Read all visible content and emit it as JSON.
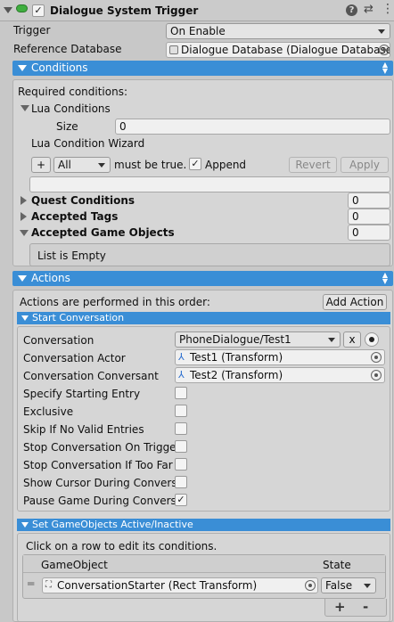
{
  "header": {
    "title": "Dialogue System Trigger",
    "enabled_checked": "✓",
    "trigger_label": "Trigger",
    "trigger_value": "On Enable",
    "refdb_label": "Reference Database",
    "refdb_value": "Dialogue Database (Dialogue Database"
  },
  "conditions": {
    "header": "Conditions",
    "required": "Required conditions:",
    "lua_conditions": "Lua Conditions",
    "size_label": "Size",
    "size_value": "0",
    "wizard_label": "Lua Condition Wizard",
    "plus": "+",
    "all_value": "All",
    "must_be_true": "must be true.",
    "append_check": "✓",
    "append_label": "Append",
    "revert": "Revert",
    "apply": "Apply",
    "quest_conditions": "Quest Conditions",
    "quest_value": "0",
    "accepted_tags": "Accepted Tags",
    "tags_value": "0",
    "accepted_gameobjects": "Accepted Game Objects",
    "gameobjects_value": "0",
    "list_empty": "List is Empty"
  },
  "actions": {
    "header": "Actions",
    "order_text": "Actions are performed in this order:",
    "add_action": "Add Action",
    "start_conversation": {
      "header": "Start Conversation",
      "conversation_label": "Conversation",
      "conversation_value": "PhoneDialogue/Test1",
      "x_button": "x",
      "actor_label": "Conversation Actor",
      "actor_value": "Test1 (Transform)",
      "conversant_label": "Conversation Conversant",
      "conversant_value": "Test2 (Transform)",
      "rows": [
        {
          "label": "Specify Starting Entry",
          "check": ""
        },
        {
          "label": "Exclusive",
          "check": ""
        },
        {
          "label": "Skip If No Valid Entries",
          "check": ""
        },
        {
          "label": "Stop Conversation On Trigger",
          "check": ""
        },
        {
          "label": "Stop Conversation If Too Far",
          "check": ""
        },
        {
          "label": "Show Cursor During Conversa",
          "check": ""
        },
        {
          "label": "Pause Game During Conversa",
          "check": "✓"
        }
      ]
    },
    "set_active": {
      "header": "Set GameObjects Active/Inactive",
      "hint": "Click on a row to edit its conditions.",
      "col_gameobject": "GameObject",
      "col_state": "State",
      "row_object": "ConversationStarter (Rect Transform)",
      "row_state": "False",
      "plus": "+",
      "minus": "-"
    }
  },
  "colors": {
    "accent": "#3a8ed6",
    "background": "#c8c8c8"
  },
  "icons": [
    "component-icon",
    "help-icon",
    "settings-icon",
    "menu-icon",
    "object-picker-icon",
    "transform-icon",
    "rect-transform-icon",
    "drag-handle-icon"
  ]
}
